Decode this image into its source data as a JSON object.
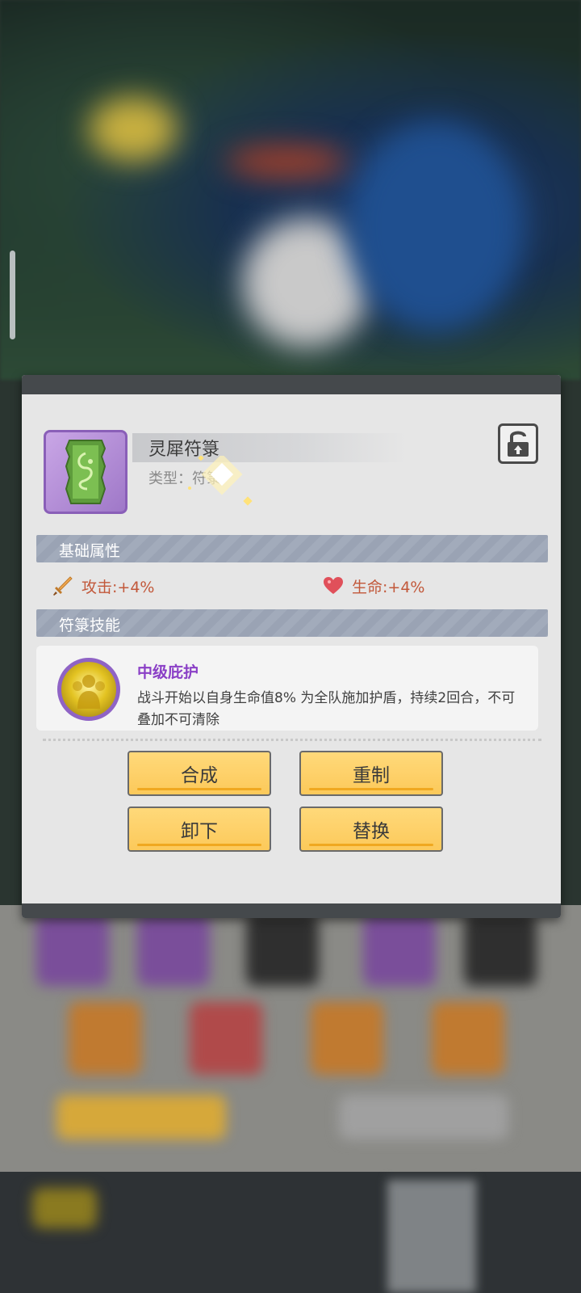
{
  "item": {
    "name": "灵犀符箓",
    "type_label": "类型：符箓"
  },
  "sections": {
    "base_attr": "基础属性",
    "skill": "符箓技能"
  },
  "stats": {
    "attack": "攻击:+4%",
    "hp": "生命:+4%"
  },
  "skill": {
    "name": "中级庇护",
    "description": "战斗开始以自身生命值8% 为全队施加护盾，持续2回合，不可叠加不可清除"
  },
  "buttons": {
    "compose": "合成",
    "reforge": "重制",
    "unequip": "卸下",
    "replace": "替换"
  },
  "colors": {
    "button_bg": "#fcc95a",
    "section_bar": "#9aa3b4",
    "skill_name": "#8a3fc6",
    "stat_text": "#c2583a"
  }
}
